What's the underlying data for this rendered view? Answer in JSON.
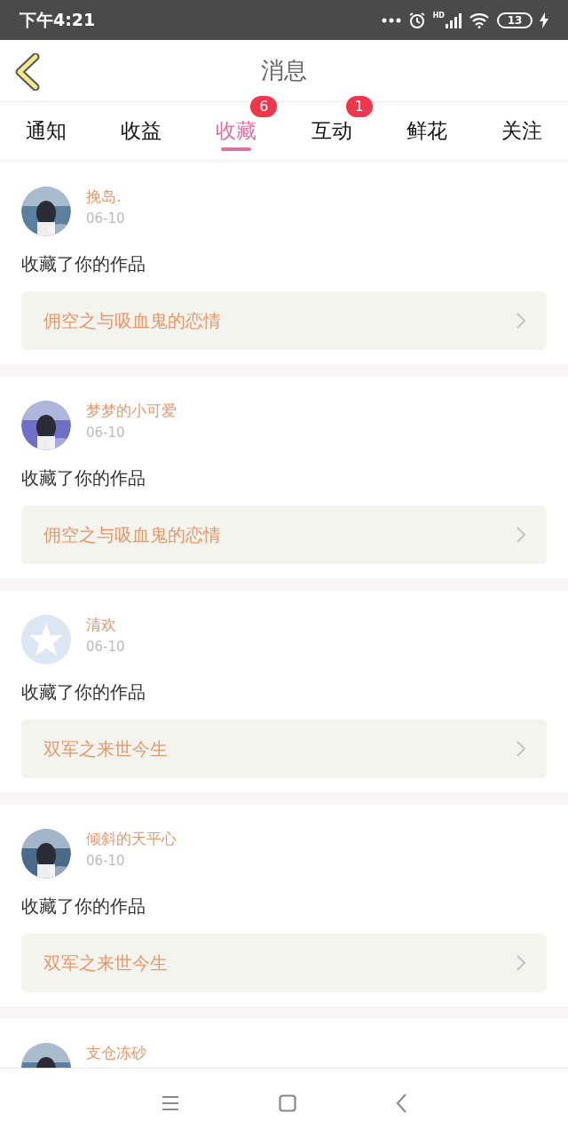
{
  "status_bar": {
    "time": "下午4:21",
    "battery": "13",
    "network_label": "HD"
  },
  "header": {
    "title": "消息"
  },
  "tabs": [
    {
      "label": "通知",
      "selected": false
    },
    {
      "label": "收益",
      "selected": false
    },
    {
      "label": "收藏",
      "selected": true,
      "badge": "6"
    },
    {
      "label": "互动",
      "selected": false,
      "badge": "1"
    },
    {
      "label": "鲜花",
      "selected": false
    },
    {
      "label": "关注",
      "selected": false
    }
  ],
  "messages": [
    {
      "name": "挽岛.",
      "date": "06-10",
      "text": "收藏了你的作品",
      "work": "佣空之与吸血鬼的恋情"
    },
    {
      "name": "梦梦的小可爱",
      "date": "06-10",
      "text": "收藏了你的作品",
      "work": "佣空之与吸血鬼的恋情"
    },
    {
      "avatar": {
        "kind": "default"
      },
      "name": "清欢",
      "date": "06-10",
      "text": "收藏了你的作品",
      "work": "双军之来世今生"
    },
    {
      "name": "倾斜的天平心",
      "date": "06-10",
      "text": "收藏了你的作品",
      "work": "双军之来世今生"
    },
    {
      "name": "支仓冻砂"
    }
  ]
}
